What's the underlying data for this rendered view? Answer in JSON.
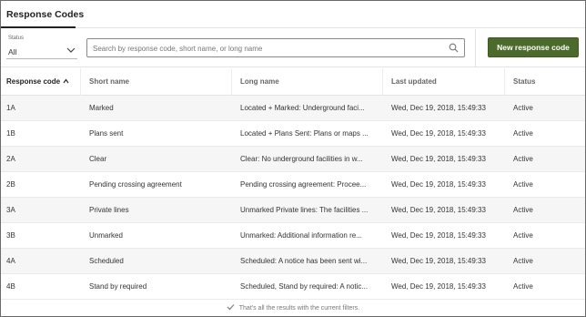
{
  "tabs": {
    "active": "Response Codes"
  },
  "filters": {
    "status_caption": "Status",
    "status_value": "All",
    "search_placeholder": "Search by response code, short name, or long name",
    "new_button": "New response code"
  },
  "table": {
    "columns": [
      "Response code",
      "Short name",
      "Long name",
      "Last updated",
      "Status"
    ],
    "sorted_column": "Response code",
    "sort_direction": "ascending",
    "rows": [
      [
        "1A",
        "Marked",
        "Located + Marked: Underground faci...",
        "Wed, Dec 19, 2018, 15:49:33",
        "Active"
      ],
      [
        "1B",
        "Plans sent",
        "Located + Plans Sent: Plans or maps ...",
        "Wed, Dec 19, 2018, 15:49:33",
        "Active"
      ],
      [
        "2A",
        "Clear",
        "Clear: No underground facilities in w...",
        "Wed, Dec 19, 2018, 15:49:33",
        "Active"
      ],
      [
        "2B",
        "Pending crossing agreement",
        "Pending crossing agreement: Procee...",
        "Wed, Dec 19, 2018, 15:49:33",
        "Active"
      ],
      [
        "3A",
        "Private lines",
        "Unmarked Private lines: The facilities ...",
        "Wed, Dec 19, 2018, 15:49:33",
        "Active"
      ],
      [
        "3B",
        "Unmarked",
        "Unmarked: Additional information re...",
        "Wed, Dec 19, 2018, 15:49:33",
        "Active"
      ],
      [
        "4A",
        "Scheduled",
        "Scheduled: A notice has been sent wi...",
        "Wed, Dec 19, 2018, 15:49:33",
        "Active"
      ],
      [
        "4B",
        "Stand by required",
        "Scheduled, Stand by required: A notic...",
        "Wed, Dec 19, 2018, 15:49:33",
        "Active"
      ]
    ]
  },
  "footer": {
    "message": "That's all the results with the current filters."
  },
  "colors": {
    "primary_button": "#4c6a2b",
    "alt_row": "#f6f6f6"
  },
  "icons": {
    "search": "search-icon",
    "dropdown": "chevron-down-icon",
    "sort": "sort-up-icon",
    "done": "check-icon"
  }
}
